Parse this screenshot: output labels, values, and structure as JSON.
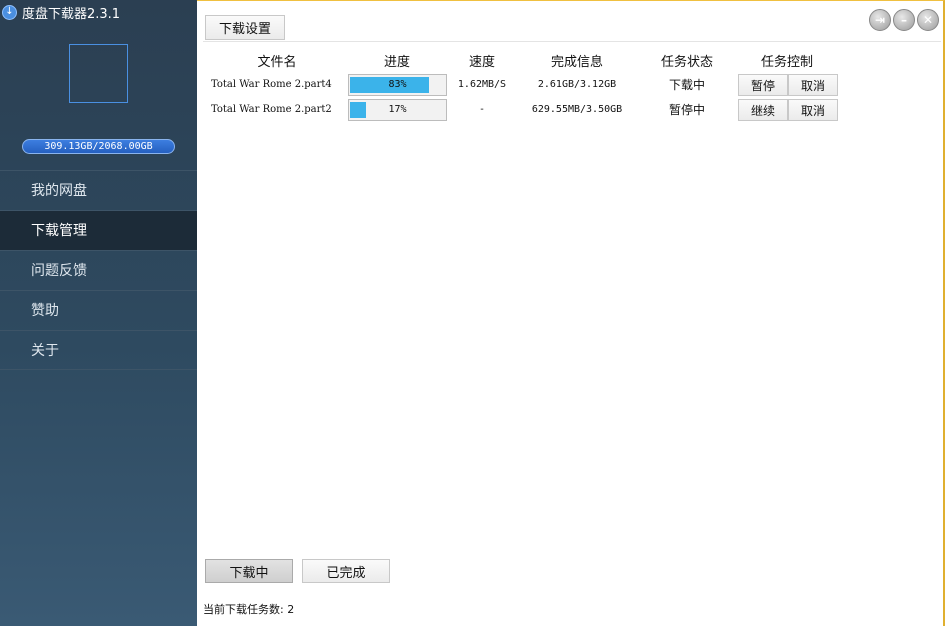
{
  "app": {
    "title": "度盘下载器2.3.1",
    "icon": "download-arrow-icon"
  },
  "sidebar": {
    "quota": "309.13GB/2068.00GB",
    "items": [
      {
        "label": "我的网盘",
        "active": false
      },
      {
        "label": "下载管理",
        "active": true
      },
      {
        "label": "问题反馈",
        "active": false
      },
      {
        "label": "赞助",
        "active": false
      },
      {
        "label": "关于",
        "active": false
      }
    ]
  },
  "toolbar": {
    "settings_label": "下载设置"
  },
  "window_controls": [
    "exit-icon",
    "minimize-icon",
    "close-icon"
  ],
  "table": {
    "headers": [
      "文件名",
      "进度",
      "速度",
      "完成信息",
      "任务状态",
      "任务控制"
    ],
    "rows": [
      {
        "filename": "Total War Rome 2.part4",
        "progress_label": "83%",
        "progress": 0.83,
        "speed": "1.62MB/S",
        "info": "2.61GB/3.12GB",
        "status": "下载中",
        "action_primary": "暂停",
        "action_cancel": "取消"
      },
      {
        "filename": "Total War Rome 2.part2",
        "progress_label": "17%",
        "progress": 0.17,
        "speed": "-",
        "info": "629.55MB/3.50GB",
        "status": "暂停中",
        "action_primary": "继续",
        "action_cancel": "取消"
      }
    ]
  },
  "tabs": {
    "downloading": "下载中",
    "completed": "已完成"
  },
  "footer": {
    "task_count": "当前下载任务数: 2"
  },
  "colors": {
    "sidebar_bg": "#2e4a60",
    "progress_fill": "#3bb3ea",
    "quota_bar": "#2f6fd0"
  }
}
